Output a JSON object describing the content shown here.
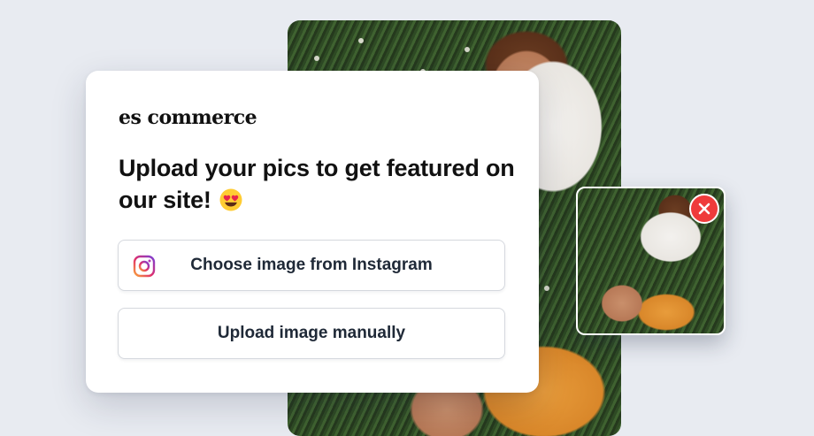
{
  "brand": {
    "name": "es commerce"
  },
  "card": {
    "headline": "Upload your pics to get featured on our site!",
    "headline_emoji": "heart-eyes-emoji"
  },
  "buttons": {
    "instagram_label": "Choose image from Instagram",
    "instagram_icon": "instagram-icon",
    "upload_label": "Upload image manually"
  },
  "thumbnail": {
    "close_icon": "close-icon",
    "close_color": "#ef3b3b"
  },
  "colors": {
    "background": "#e8ebf1",
    "card": "#ffffff",
    "text": "#111111",
    "button_border": "#d5d8de"
  }
}
